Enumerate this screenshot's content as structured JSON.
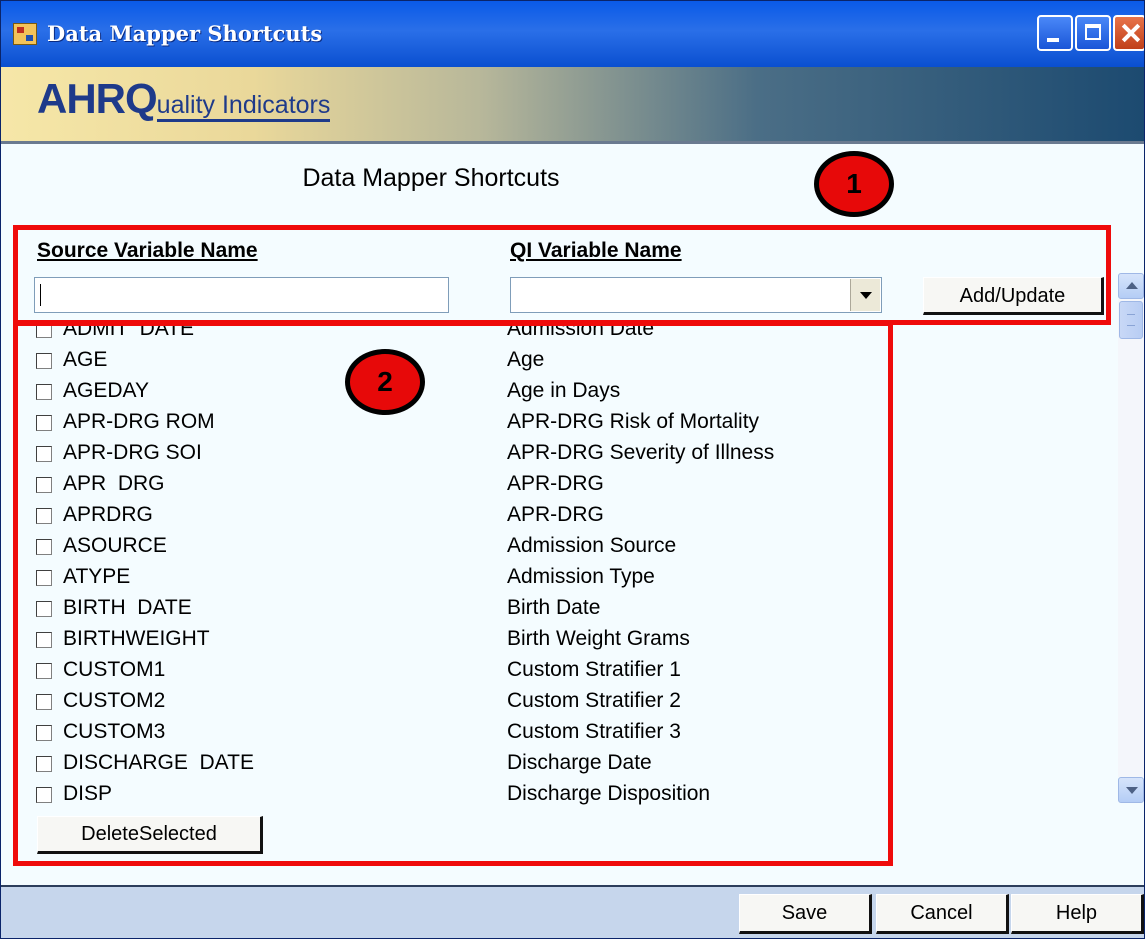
{
  "window": {
    "title": "Data Mapper Shortcuts",
    "controls": [
      "minimize",
      "maximize",
      "close"
    ]
  },
  "banner": {
    "logo_ahrq": "AHRQ",
    "logo_rest": "uality Indicators"
  },
  "form": {
    "heading": "Data Mapper Shortcuts",
    "source_label": "Source Variable Name",
    "qi_label": "QI Variable Name",
    "source_value": "",
    "qi_selected": "",
    "add_update_label": "Add/Update",
    "delete_selected_label": "DeleteSelected"
  },
  "annotations": {
    "callout_1": "1",
    "callout_2": "2",
    "color": "#ef0b0b"
  },
  "mappings": [
    {
      "source": "ADMIT  DATE",
      "qi": "Admission Date",
      "checked": false
    },
    {
      "source": "AGE",
      "qi": "Age",
      "checked": false
    },
    {
      "source": "AGEDAY",
      "qi": "Age in Days",
      "checked": false
    },
    {
      "source": "APR-DRG ROM",
      "qi": "APR-DRG Risk of Mortality",
      "checked": false
    },
    {
      "source": "APR-DRG SOI",
      "qi": "APR-DRG Severity of Illness",
      "checked": false
    },
    {
      "source": "APR  DRG",
      "qi": "APR-DRG",
      "checked": false
    },
    {
      "source": "APRDRG",
      "qi": "APR-DRG",
      "checked": false
    },
    {
      "source": "ASOURCE",
      "qi": "Admission Source",
      "checked": false
    },
    {
      "source": "ATYPE",
      "qi": "Admission Type",
      "checked": false
    },
    {
      "source": "BIRTH  DATE",
      "qi": "Birth Date",
      "checked": false
    },
    {
      "source": "BIRTHWEIGHT",
      "qi": "Birth Weight Grams",
      "checked": false
    },
    {
      "source": "CUSTOM1",
      "qi": "Custom Stratifier 1",
      "checked": false
    },
    {
      "source": "CUSTOM2",
      "qi": "Custom Stratifier 2",
      "checked": false
    },
    {
      "source": "CUSTOM3",
      "qi": "Custom Stratifier 3",
      "checked": false
    },
    {
      "source": "DISCHARGE  DATE",
      "qi": "Discharge Date",
      "checked": false
    },
    {
      "source": "DISP",
      "qi": "Discharge Disposition",
      "checked": false
    }
  ],
  "footer": {
    "save_label": "Save",
    "cancel_label": "Cancel",
    "help_label": "Help"
  },
  "colors": {
    "title_bar": "#0a5ae8",
    "window_bg": "#f4fcff",
    "footer_bg": "#c6d6ec",
    "logo_blue": "#1e3a8a"
  }
}
